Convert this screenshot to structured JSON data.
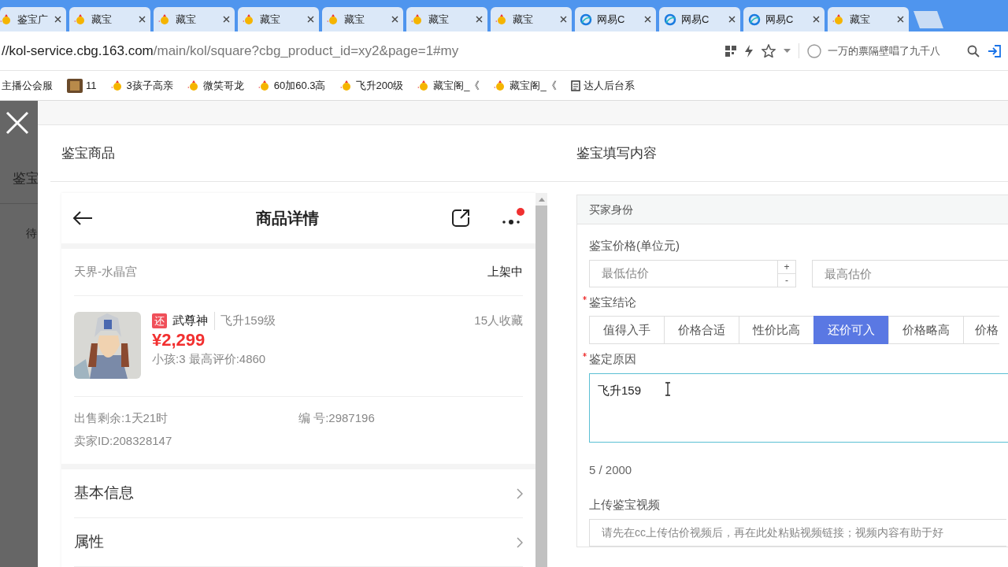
{
  "browser": {
    "tabs": [
      {
        "label": "鉴宝广",
        "kind": "chick"
      },
      {
        "label": "藏宝",
        "kind": "chick"
      },
      {
        "label": "藏宝",
        "kind": "chick"
      },
      {
        "label": "藏宝",
        "kind": "chick"
      },
      {
        "label": "藏宝",
        "kind": "chick"
      },
      {
        "label": "藏宝",
        "kind": "chick"
      },
      {
        "label": "藏宝",
        "kind": "chick"
      },
      {
        "label": "网易C",
        "kind": "globe"
      },
      {
        "label": "网易C",
        "kind": "globe"
      },
      {
        "label": "网易C",
        "kind": "globe"
      },
      {
        "label": "藏宝",
        "kind": "chick"
      }
    ],
    "address": {
      "host": "//kol-service.cbg.163.com",
      "path": "/main/kol/square?cbg_product_id=xy2&page=1#my"
    },
    "search": {
      "value": "一万的票隔壁唱了九千八"
    },
    "bookmarks": [
      {
        "label": "主播公会服",
        "kind": "plain"
      },
      {
        "label": "11",
        "kind": "thumb"
      },
      {
        "label": "3孩子高亲",
        "kind": "chick"
      },
      {
        "label": "微笑哥龙",
        "kind": "chick"
      },
      {
        "label": "60加60.3高",
        "kind": "chick"
      },
      {
        "label": "飞升200级",
        "kind": "chick"
      },
      {
        "label": "藏宝阁_《",
        "kind": "chick"
      },
      {
        "label": "藏宝阁_《",
        "kind": "chick"
      },
      {
        "label": "达人后台系",
        "kind": "page"
      }
    ]
  },
  "background": {
    "heading": "鉴宝",
    "tab": "待"
  },
  "goods": {
    "title": "鉴宝商品",
    "phone": {
      "title": "商品详情",
      "server": "天界-水晶宫",
      "status": "上架中",
      "item": {
        "tag": "还",
        "name": "武尊神",
        "level": "飞升159级",
        "favorites": "15人收藏",
        "price": "¥2,299",
        "stats": "小孩:3 最高评价:4860"
      },
      "info": [
        "出售剩余:1天21时",
        "编 号:2987196",
        "卖家ID:208328147"
      ],
      "sections": [
        "基本信息",
        "属性"
      ]
    }
  },
  "form": {
    "title": "鉴宝填写内容",
    "panel_title": "买家身份",
    "price": {
      "label": "鉴宝价格(单位元)",
      "min_placeholder": "最低估价",
      "spinner": [
        "+",
        "-"
      ],
      "max_placeholder": "最高估价"
    },
    "conclusion": {
      "label": "鉴宝结论",
      "required": true,
      "options": [
        {
          "label": "值得入手",
          "selected": false
        },
        {
          "label": "价格合适",
          "selected": false
        },
        {
          "label": "性价比高",
          "selected": false
        },
        {
          "label": "还价可入",
          "selected": true
        },
        {
          "label": "价格略高",
          "selected": false
        },
        {
          "label": "价格",
          "selected": false
        }
      ]
    },
    "reason": {
      "label": "鉴定原因",
      "required": true,
      "value": "飞升159",
      "focused": true,
      "counter": "5 / 2000"
    },
    "video": {
      "label": "上传鉴宝视频",
      "placeholder": "请先在cc上传估价视频后，再在此处粘贴视频链接；视频内容有助于好"
    }
  }
}
